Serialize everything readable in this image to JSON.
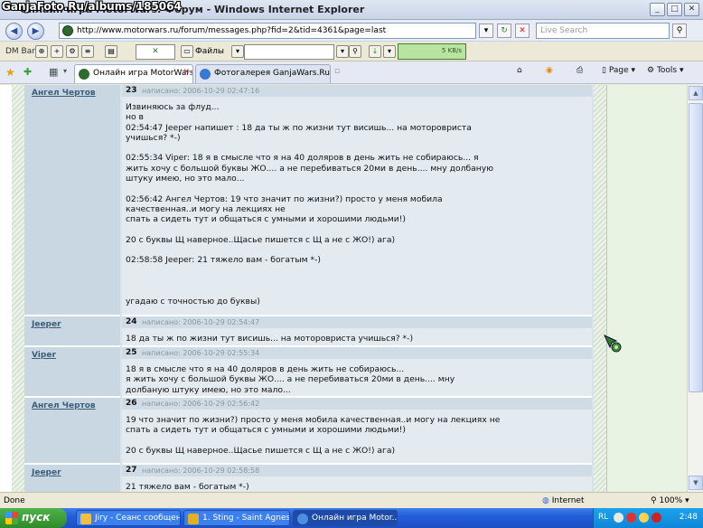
{
  "watermark": "GanjaFoto.Ru/albums/185064",
  "window": {
    "title": "Онлайн игра MotorWars: Форум - Windows Internet Explorer",
    "minimize": "_",
    "maximize": "□",
    "close": "✕"
  },
  "address": {
    "url": "http://www.motorwars.ru/forum/messages.php?fid=2&tid=4361&page=last",
    "search_placeholder": "Live Search"
  },
  "dmbar": {
    "label": "DM Bar",
    "files_label": "Файлы",
    "speed": "5 KB/s"
  },
  "tabs": [
    {
      "label": "Онлайн игра MotorWars...",
      "active": true
    },
    {
      "label": "Фотогалерея GanjaWars.Ru",
      "active": false
    }
  ],
  "tools": {
    "page": "Page",
    "tools": "Tools"
  },
  "posts": [
    {
      "number": "23",
      "author": "Ангел Чертов",
      "posted": "написано: 2006-10-29 02:47:16",
      "lines": [
        "Извиняюсь за флуд...",
        "но в",
        "02:54:47 Jeeper напишет : 18 да ты ж по жизни тут висишь... на моторовриста",
        "учишься? *-)",
        "",
        "02:55:34 Viper: 18 я в смысле что я на 40 доляров в день жить не собираюсь... я",
        "жить хочу с большой буквы ЖО.... а не перебиваться 20ми в день.... мну долбаную",
        "штуку имею, но это мало...",
        "",
        "02:56:42 Ангел Чертов: 19 что значит по жизни?) просто у меня мобила",
        "качественная..и могу на лекциях не",
        "спать а сидеть тут и общаться с умными и хорошими людьми!)",
        "",
        "20 с буквы Щ наверное..Щасье пишется с Щ а не с ЖО!) ага)",
        "",
        "02:58:58 Jeeper: 21 тяжело вам - богатым *-)",
        "",
        "",
        "",
        "угадаю с точностью до буквы)"
      ]
    },
    {
      "number": "24",
      "author": "Jeeper",
      "posted": "написано: 2006-10-29 02:54:47",
      "lines": [
        "18 да ты ж по жизни тут висишь... на моторовриста учишься? *-)"
      ]
    },
    {
      "number": "25",
      "author": "Viper",
      "posted": "написано: 2006-10-29 02:55:34",
      "lines": [
        "18 я в смысле что я на 40 доляров в день жить не собираюсь...",
        "я жить хочу с большой буквы ЖО.... а не перебиваться 20ми в день.... мну",
        "долбаную штуку имею, но это мало..."
      ]
    },
    {
      "number": "26",
      "author": "Ангел Чертов",
      "posted": "написано: 2006-10-29 02:56:42",
      "lines": [
        "19 что значит по жизни?) просто у меня мобила качественная..и могу на лекциях не",
        "спать а сидеть тут и общаться с умными и хорошими людьми!)",
        "",
        "20 с буквы Щ наверное..Щасье пишется с Щ а не с ЖО!) ага)"
      ]
    },
    {
      "number": "27",
      "author": "Jeeper",
      "posted": "написано: 2006-10-29 02:58:58",
      "lines": [
        "21 тяжело вам - богатым *-)"
      ]
    }
  ],
  "status": {
    "text": "Done",
    "zone": "Internet",
    "zoom": "100%"
  },
  "taskbar": {
    "start": "пуск",
    "tasks": [
      "Jiry - Сеанс сообщен...",
      "1. Sting - Saint Agnes...",
      "Онлайн игра Motor..."
    ],
    "lang": "RL",
    "clock": "2:48"
  }
}
